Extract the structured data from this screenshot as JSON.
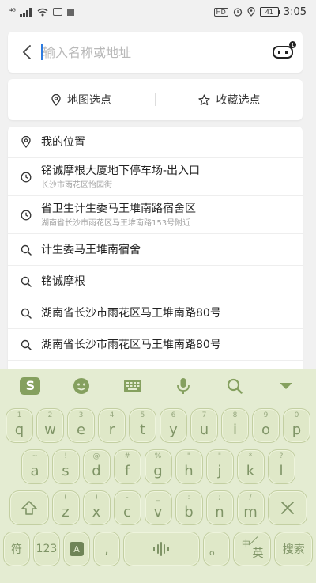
{
  "status_bar": {
    "signal": "⁴ᴳ",
    "hd": "HD",
    "battery": "41",
    "time": "3:05"
  },
  "search": {
    "placeholder": "输入名称或地址",
    "robot_badge": "1"
  },
  "select": {
    "map_label": "地图选点",
    "favorites_label": "收藏选点"
  },
  "list": {
    "my_location": "我的位置",
    "history": [
      {
        "title": "铭诚摩根大厦地下停车场-出入口",
        "sub": "长沙市雨花区怡园街"
      },
      {
        "title": "省卫生计生委马王堆南路宿舍区",
        "sub": "湖南省长沙市雨花区马王堆南路153号附近"
      }
    ],
    "suggestions": [
      "计生委马王堆南宿舍",
      "铭诚摩根",
      "湖南省长沙市雨花区马王堆南路80号",
      "湖南省长沙市雨花区马王堆南路80号"
    ]
  },
  "keyboard": {
    "logo": "S",
    "row1": [
      {
        "num": "1",
        "ch": "q"
      },
      {
        "num": "2",
        "ch": "w"
      },
      {
        "num": "3",
        "ch": "e"
      },
      {
        "num": "4",
        "ch": "r"
      },
      {
        "num": "5",
        "ch": "t"
      },
      {
        "num": "6",
        "ch": "y"
      },
      {
        "num": "7",
        "ch": "u"
      },
      {
        "num": "8",
        "ch": "i"
      },
      {
        "num": "9",
        "ch": "o"
      },
      {
        "num": "0",
        "ch": "p"
      }
    ],
    "row2": [
      {
        "num": "~",
        "ch": "a"
      },
      {
        "num": "!",
        "ch": "s"
      },
      {
        "num": "@",
        "ch": "d"
      },
      {
        "num": "#",
        "ch": "f"
      },
      {
        "num": "%",
        "ch": "g"
      },
      {
        "num": "\"",
        "ch": "h"
      },
      {
        "num": "\"",
        "ch": "j"
      },
      {
        "num": "*",
        "ch": "k"
      },
      {
        "num": "?",
        "ch": "l"
      }
    ],
    "row3": [
      {
        "num": "(",
        "ch": "z"
      },
      {
        "num": ")",
        "ch": "x"
      },
      {
        "num": "-",
        "ch": "c"
      },
      {
        "num": "_",
        "ch": "v"
      },
      {
        "num": ":",
        "ch": "b"
      },
      {
        "num": ";",
        "ch": "n"
      },
      {
        "num": "/",
        "ch": "m"
      }
    ],
    "fu": "符",
    "num123": "123",
    "ai": "A",
    "comma": ",",
    "period": "。",
    "zh_top": "中",
    "zh_bottom": "英",
    "search": "搜索"
  },
  "colors": {
    "keyboard_bg": "#e4ecd2",
    "key_text": "#7f9466",
    "caret": "#2d7be0"
  }
}
